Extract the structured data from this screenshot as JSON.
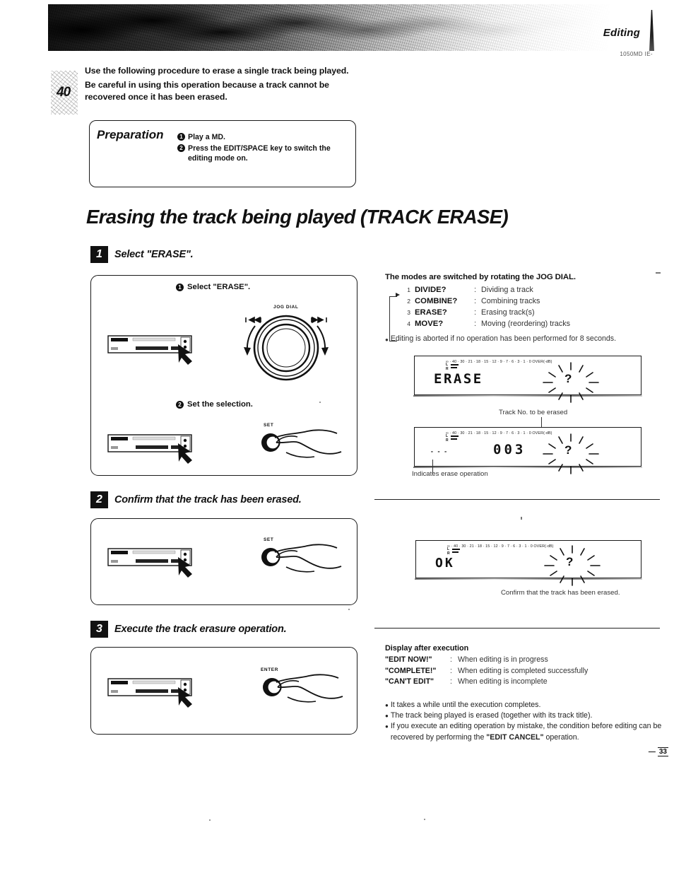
{
  "header": {
    "section_title": "Editing",
    "doc_code": "1050MD IE-",
    "page_marker": "40"
  },
  "intro": {
    "line1": "Use the following procedure to erase a single track being played.",
    "line2": "Be careful in using this operation because a track cannot be recovered once it has been erased."
  },
  "preparation": {
    "title": "Preparation",
    "items": [
      {
        "num": "1",
        "text": "Play a MD."
      },
      {
        "num": "2",
        "text": "Press the EDIT/SPACE key to switch the editing mode on."
      }
    ]
  },
  "main_heading": "Erasing the track being played (TRACK ERASE)",
  "steps": [
    {
      "num": "1",
      "label": "Select \"ERASE\"."
    },
    {
      "num": "2",
      "label": "Confirm that the track has been erased."
    },
    {
      "num": "3",
      "label": "Execute the track erasure operation."
    }
  ],
  "step1_box": {
    "sub1": {
      "num": "1",
      "text": "Select \"ERASE\"."
    },
    "sub2": {
      "num": "2",
      "text": "Set the selection."
    },
    "jog_label": "JOG DIAL",
    "set_label": "SET"
  },
  "step2_box": {
    "set_label": "SET"
  },
  "step3_box": {
    "enter_label": "ENTER"
  },
  "modes": {
    "title": "The modes are switched by rotating the JOG DIAL.",
    "rows": [
      {
        "idx": "1",
        "name": "DIVIDE?",
        "desc": "Dividing a track"
      },
      {
        "idx": "2",
        "name": "COMBINE?",
        "desc": "Combining tracks"
      },
      {
        "idx": "3",
        "name": "ERASE?",
        "desc": "Erasing track(s)"
      },
      {
        "idx": "4",
        "name": "MOVE?",
        "desc": "Moving (reordering) tracks"
      }
    ],
    "note": "Editing is aborted if no operation has been performed for 8 seconds."
  },
  "display_meter": {
    "scale": "∞ · 40 · 30 · 21 · 18 · 15 · 12 · 9 · 7 · 6 · 3 · 1 · 0 OVER(-dB)",
    "left_label": "L",
    "right_label": "R",
    "unit_label": "OVER(-dB)"
  },
  "displays": [
    {
      "name": "erase-prompt",
      "text": "ERASE",
      "blink": "?"
    },
    {
      "name": "track-number",
      "text": "003",
      "blink": "?",
      "dash": "- - -",
      "caption_top": "Track No. to be erased",
      "caption_bottom": "Indicates erase operation"
    },
    {
      "name": "ok-prompt",
      "text": "OK",
      "blink": "?",
      "caption_bottom": "Confirm that the track has been erased."
    }
  ],
  "display_after_execution": {
    "title": "Display after execution",
    "rows": [
      {
        "key": "\"EDIT NOW!\"",
        "sep": ":",
        "val": "When editing is in progress"
      },
      {
        "key": "\"COMPLETE!\"",
        "sep": ":",
        "val": "When editing is completed successfully"
      },
      {
        "key": "\"CAN'T EDIT\"",
        "sep": ":",
        "val": "When editing is incomplete"
      }
    ]
  },
  "bullets": [
    {
      "pre": "It takes a while until the execution completes.",
      "bold": "",
      "post": ""
    },
    {
      "pre": "The track being played is erased (together with its track title).",
      "bold": "",
      "post": ""
    },
    {
      "pre": "If you execute an editing operation by mistake, the condition before editing can be recovered by performing the ",
      "bold": "\"EDIT CANCEL\"",
      "post": " operation."
    }
  ],
  "page_ref": {
    "arrow": "—",
    "number": "33"
  }
}
